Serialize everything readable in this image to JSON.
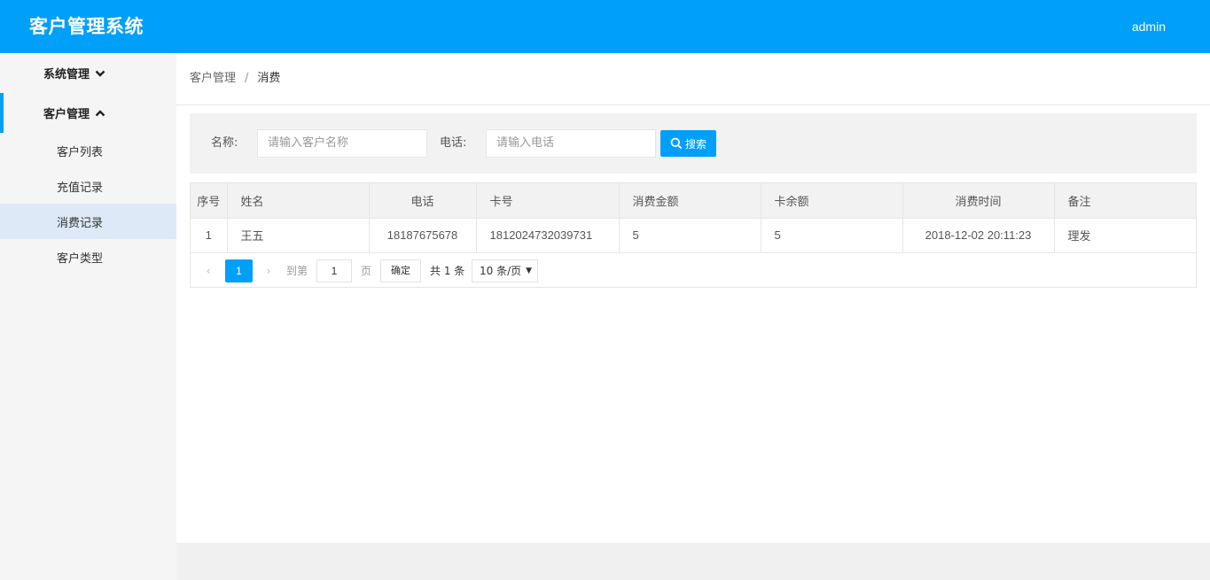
{
  "header": {
    "title": "客户管理系统",
    "user": "admin"
  },
  "sidebar": {
    "groups": [
      {
        "label": "系统管理"
      },
      {
        "label": "客户管理"
      }
    ],
    "items": [
      {
        "label": "客户列表"
      },
      {
        "label": "充值记录"
      },
      {
        "label": "消费记录"
      },
      {
        "label": "客户类型"
      }
    ]
  },
  "breadcrumb": {
    "parent": "客户管理",
    "sep": "/",
    "current": "消费"
  },
  "search": {
    "name_label": "名称:",
    "name_placeholder": "请输入客户名称",
    "phone_label": "电话:",
    "phone_placeholder": "请输入电话",
    "button": "搜索"
  },
  "table": {
    "headers": [
      "序号",
      "姓名",
      "电话",
      "卡号",
      "消费金额",
      "卡余额",
      "消费时间",
      "备注"
    ],
    "rows": [
      [
        "1",
        "王五",
        "18187675678",
        "1812024732039731",
        "5",
        "5",
        "2018-12-02 20:11:23",
        "理发"
      ]
    ]
  },
  "pager": {
    "prev": "‹",
    "next": "›",
    "current": "1",
    "goto_label": "到第",
    "goto_value": "1",
    "page_unit": "页",
    "confirm": "确定",
    "total": "共 1 条",
    "page_size": "10 条/页"
  },
  "colors": {
    "accent": "#009ffa",
    "sidebar_bg": "#f5f5f5",
    "selected_bg": "#dde9f7"
  }
}
